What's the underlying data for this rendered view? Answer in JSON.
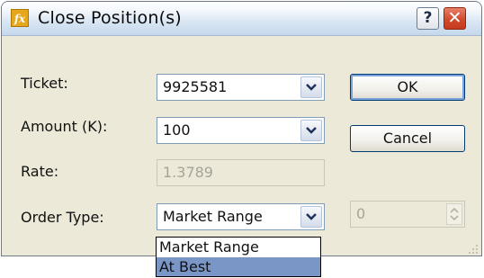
{
  "window": {
    "title": "Close Position(s)",
    "icon_label": "fx",
    "help_label": "?",
    "close_label": "✕"
  },
  "form": {
    "ticket": {
      "label": "Ticket:",
      "value": "9925581"
    },
    "amount": {
      "label": "Amount (K):",
      "value": "100"
    },
    "rate": {
      "label": "Rate:",
      "value": "1.3789"
    },
    "order_type": {
      "label": "Order Type:",
      "value": "Market Range"
    },
    "range_value": "0"
  },
  "buttons": {
    "ok": "OK",
    "cancel": "Cancel"
  },
  "order_type_options": [
    "Market Range",
    "At Best"
  ],
  "colors": {
    "selected_option": "#7a96c6",
    "dialog_bg": "#ece9d8",
    "close_button": "#d04a2c"
  },
  "icons": [
    "fx-app-icon",
    "help-icon",
    "close-icon",
    "chevron-down-icon",
    "spin-arrows-icon",
    "resize-grip-icon"
  ]
}
